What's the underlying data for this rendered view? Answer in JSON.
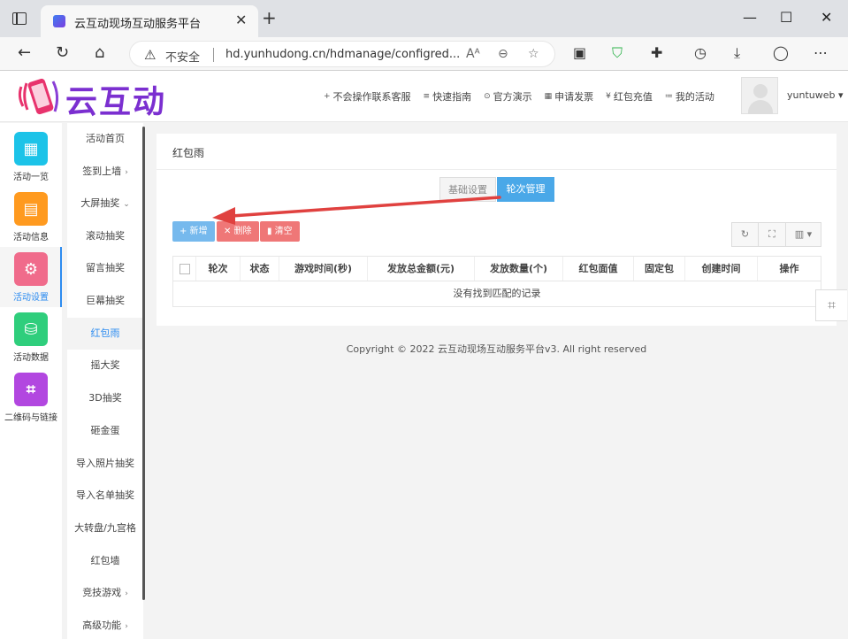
{
  "browser": {
    "tab_title": "云互动现场互动服务平台",
    "tab_close": "✕",
    "new_tab": "+",
    "window_controls": {
      "minimize": "—",
      "maximize": "☐",
      "close": "✕"
    },
    "insecure_label": "不安全",
    "url": "hd.yunhudong.cn/hdmanage/configred...",
    "icons": [
      "back-icon",
      "refresh-icon",
      "home-icon",
      "read-aloud-icon",
      "zoom-icon",
      "favorite-icon",
      "extension-icon",
      "shield-icon",
      "puzzle-icon",
      "history-icon",
      "download-icon",
      "profile-icon",
      "more-icon"
    ]
  },
  "header": {
    "logo_text": "云互动",
    "links": [
      {
        "icon": "+",
        "label": "不会操作联系客服"
      },
      {
        "icon": "≡",
        "label": "快速指南"
      },
      {
        "icon": "⊙",
        "label": "官方演示"
      },
      {
        "icon": "▦",
        "label": "申请发票"
      },
      {
        "icon": "¥",
        "label": "红包充值"
      },
      {
        "icon": "≔",
        "label": "我的活动"
      }
    ],
    "username": "yuntuweb",
    "username_caret": "▾"
  },
  "rail": {
    "items": [
      {
        "label": "活动一览",
        "color": "#1cc3e8",
        "glyph": "▦"
      },
      {
        "label": "活动信息",
        "color": "#ff9a1f",
        "glyph": "▤"
      },
      {
        "label": "活动设置",
        "color": "#f06b8b",
        "glyph": "⚙"
      },
      {
        "label": "活动数据",
        "color": "#2fce7c",
        "glyph": "⛁"
      },
      {
        "label": "二维码与链接",
        "color": "#b247e0",
        "glyph": "⌗"
      }
    ]
  },
  "submenu": {
    "items": [
      {
        "label": "活动首页",
        "chev": ""
      },
      {
        "label": "签到上墙",
        "chev": "›"
      },
      {
        "label": "大屏抽奖",
        "chev": "⌄"
      },
      {
        "label": "滚动抽奖",
        "chev": ""
      },
      {
        "label": "留言抽奖",
        "chev": ""
      },
      {
        "label": "巨幕抽奖",
        "chev": ""
      },
      {
        "label": "红包雨",
        "chev": ""
      },
      {
        "label": "摇大奖",
        "chev": ""
      },
      {
        "label": "3D抽奖",
        "chev": ""
      },
      {
        "label": "砸金蛋",
        "chev": ""
      },
      {
        "label": "导入照片抽奖",
        "chev": ""
      },
      {
        "label": "导入名单抽奖",
        "chev": ""
      },
      {
        "label": "大转盘/九宫格",
        "chev": ""
      },
      {
        "label": "红包墙",
        "chev": ""
      },
      {
        "label": "竞技游戏",
        "chev": "›"
      },
      {
        "label": "高级功能",
        "chev": "›"
      }
    ]
  },
  "main": {
    "title": "红包雨",
    "seg_basic": "基础设置",
    "seg_rounds": "轮次管理",
    "btn_add": "+ 新增",
    "btn_delete": "✕ 删除",
    "btn_clear": "▮ 清空",
    "tools": {
      "refresh": "↻",
      "fullscreen": "⛶",
      "columns": "▥ ▾"
    },
    "columns": [
      "轮次",
      "状态",
      "游戏时间(秒)",
      "发放总金额(元)",
      "发放数量(个)",
      "红包面值",
      "固定包",
      "创建时间",
      "操作"
    ],
    "empty_text": "没有找到匹配的记录"
  },
  "footer": "Copyright © 2022 云互动现场互动服务平台v3. All right reserved",
  "colors": {
    "accent": "#2d8cf0",
    "brand": "#7b2fd0",
    "arrow": "#e0413f"
  }
}
